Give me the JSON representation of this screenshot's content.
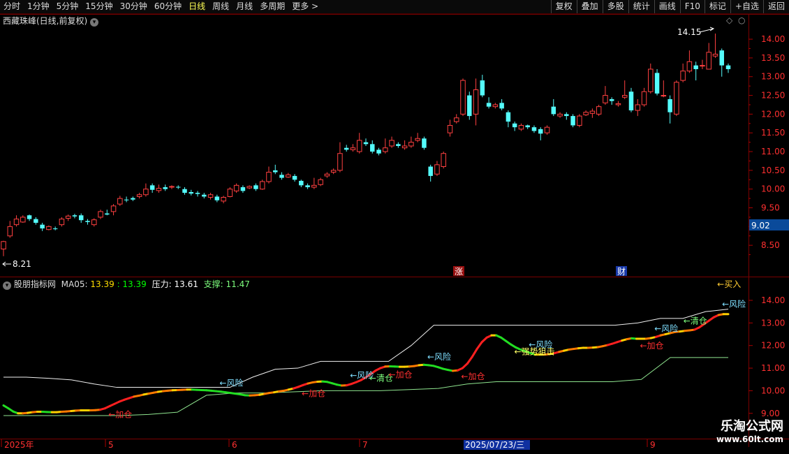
{
  "toolbar": {
    "periods": [
      "分时",
      "1分钟",
      "5分钟",
      "15分钟",
      "30分钟",
      "60分钟",
      "日线",
      "周线",
      "月线",
      "多周期",
      "更多 >"
    ],
    "active_period": "日线",
    "right_buttons": [
      "复权",
      "叠加",
      "多股",
      "统计",
      "画线",
      "F10",
      "标记",
      "+自选",
      "返回"
    ]
  },
  "main_panel": {
    "title": "西藏珠峰(日线,前复权)",
    "price_axis": [
      "14.00",
      "13.50",
      "13.00",
      "12.50",
      "12.00",
      "11.50",
      "11.00",
      "10.50",
      "10.00",
      "9.50",
      "9.00",
      "8.50"
    ],
    "current_price_tag": "9.02",
    "high_marker": "14.15",
    "low_marker": "8.21",
    "badge_zhang": "涨",
    "badge_cai": "财",
    "colors": {
      "up": "#ff4040",
      "down": "#54fcfc"
    }
  },
  "indicator_panel": {
    "title": "股朋指标网",
    "ma_label": "MA05:",
    "ma_value1": "13.39",
    "ma_value2": ": 13.39",
    "resistance_label": "压力:",
    "resistance_value": "13.61",
    "support_label": "支撑:",
    "support_value": "11.47",
    "price_axis": [
      "14.00",
      "13.00",
      "12.00",
      "11.00",
      "10.00",
      "9.00"
    ],
    "signals": [
      "←加仓",
      "←风险",
      "←加仓",
      "←风险",
      "←清仓",
      "←加仓",
      "←风险",
      "←加仓",
      "←强势狙击",
      "←风险",
      "←加仓",
      "←风险",
      "←清仓",
      "←风险",
      "←买入"
    ]
  },
  "date_axis": {
    "labels": [
      "2025年",
      "5",
      "6",
      "7",
      "9"
    ],
    "cursor_date": "2025/07/23/三"
  },
  "watermark": {
    "site_name": "乐淘公式网",
    "url": "www.60lt.com"
  },
  "chart_data": [
    {
      "type": "candlestick",
      "title": "西藏珠峰(日线,前复权)",
      "y_axis": {
        "min": 8.0,
        "max": 14.3
      },
      "up_color": "#ff4040",
      "down_color": "#54fcfc",
      "candles": [
        {
          "o": 8.4,
          "c": 8.6,
          "h": 8.62,
          "l": 8.21
        },
        {
          "o": 8.75,
          "c": 9.0,
          "h": 9.15,
          "l": 8.7
        },
        {
          "o": 9.05,
          "c": 9.2,
          "h": 9.3,
          "l": 9.0
        },
        {
          "o": 9.12,
          "c": 9.25,
          "h": 9.3,
          "l": 9.1
        },
        {
          "o": 9.3,
          "c": 9.2,
          "h": 9.32,
          "l": 9.15
        },
        {
          "o": 9.2,
          "c": 9.1,
          "h": 9.25,
          "l": 9.05
        },
        {
          "o": 9.05,
          "c": 8.95,
          "h": 9.1,
          "l": 8.88
        },
        {
          "o": 8.92,
          "c": 9.0,
          "h": 9.03,
          "l": 8.9
        },
        {
          "o": 8.95,
          "c": 8.93,
          "h": 9.0,
          "l": 8.9
        },
        {
          "o": 9.05,
          "c": 9.2,
          "h": 9.25,
          "l": 9.0
        },
        {
          "o": 9.22,
          "c": 9.28,
          "h": 9.32,
          "l": 9.15
        },
        {
          "o": 9.3,
          "c": 9.27,
          "h": 9.34,
          "l": 9.22
        },
        {
          "o": 9.3,
          "c": 9.17,
          "h": 9.35,
          "l": 9.1
        },
        {
          "o": 9.15,
          "c": 9.12,
          "h": 9.2,
          "l": 9.05
        },
        {
          "o": 9.05,
          "c": 9.18,
          "h": 9.22,
          "l": 9.0
        },
        {
          "o": 9.25,
          "c": 9.4,
          "h": 9.45,
          "l": 9.2
        },
        {
          "o": 9.35,
          "c": 9.32,
          "h": 9.45,
          "l": 9.3
        },
        {
          "o": 9.4,
          "c": 9.55,
          "h": 9.6,
          "l": 9.3
        },
        {
          "o": 9.6,
          "c": 9.75,
          "h": 9.82,
          "l": 9.55
        },
        {
          "o": 9.72,
          "c": 9.7,
          "h": 9.8,
          "l": 9.65
        },
        {
          "o": 9.76,
          "c": 9.72,
          "h": 9.8,
          "l": 9.68
        },
        {
          "o": 9.8,
          "c": 9.85,
          "h": 9.9,
          "l": 9.75
        },
        {
          "o": 9.85,
          "c": 10.0,
          "h": 10.15,
          "l": 9.8
        },
        {
          "o": 10.1,
          "c": 9.98,
          "h": 10.15,
          "l": 9.9
        },
        {
          "o": 9.96,
          "c": 10.02,
          "h": 10.12,
          "l": 9.9
        },
        {
          "o": 10.05,
          "c": 10.0,
          "h": 10.12,
          "l": 9.95
        },
        {
          "o": 10.05,
          "c": 10.07,
          "h": 10.1,
          "l": 10.0
        },
        {
          "o": 10.06,
          "c": 10.04,
          "h": 10.1,
          "l": 10.0
        },
        {
          "o": 10.0,
          "c": 9.9,
          "h": 10.05,
          "l": 9.85
        },
        {
          "o": 9.92,
          "c": 9.88,
          "h": 9.98,
          "l": 9.83
        },
        {
          "o": 9.9,
          "c": 9.87,
          "h": 9.95,
          "l": 9.8
        },
        {
          "o": 9.85,
          "c": 9.8,
          "h": 9.9,
          "l": 9.75
        },
        {
          "o": 9.78,
          "c": 9.85,
          "h": 9.9,
          "l": 9.72
        },
        {
          "o": 9.8,
          "c": 9.7,
          "h": 9.85,
          "l": 9.65
        },
        {
          "o": 9.68,
          "c": 9.78,
          "h": 9.82,
          "l": 9.62
        },
        {
          "o": 9.8,
          "c": 10.0,
          "h": 10.05,
          "l": 9.78
        },
        {
          "o": 9.95,
          "c": 10.1,
          "h": 10.15,
          "l": 9.9
        },
        {
          "o": 10.05,
          "c": 9.95,
          "h": 10.1,
          "l": 9.9
        },
        {
          "o": 10.03,
          "c": 10.07,
          "h": 10.1,
          "l": 10.0
        },
        {
          "o": 10.1,
          "c": 10.0,
          "h": 10.15,
          "l": 9.95
        },
        {
          "o": 10.0,
          "c": 10.2,
          "h": 10.25,
          "l": 9.98
        },
        {
          "o": 10.2,
          "c": 10.45,
          "h": 10.6,
          "l": 10.15
        },
        {
          "o": 10.5,
          "c": 10.45,
          "h": 10.65,
          "l": 10.4
        },
        {
          "o": 10.38,
          "c": 10.3,
          "h": 10.45,
          "l": 10.25
        },
        {
          "o": 10.32,
          "c": 10.38,
          "h": 10.43,
          "l": 10.3
        },
        {
          "o": 10.35,
          "c": 10.25,
          "h": 10.4,
          "l": 10.2
        },
        {
          "o": 10.22,
          "c": 10.1,
          "h": 10.25,
          "l": 10.05
        },
        {
          "o": 10.1,
          "c": 10.05,
          "h": 10.15,
          "l": 10.0
        },
        {
          "o": 10.05,
          "c": 10.1,
          "h": 10.3,
          "l": 10.0
        },
        {
          "o": 10.12,
          "c": 10.25,
          "h": 10.3,
          "l": 10.08
        },
        {
          "o": 10.35,
          "c": 10.4,
          "h": 10.45,
          "l": 10.3
        },
        {
          "o": 10.45,
          "c": 10.5,
          "h": 10.55,
          "l": 10.4
        },
        {
          "o": 10.5,
          "c": 10.95,
          "h": 11.25,
          "l": 10.45
        },
        {
          "o": 11.1,
          "c": 11.05,
          "h": 11.18,
          "l": 11.0
        },
        {
          "o": 11.05,
          "c": 11.1,
          "h": 11.2,
          "l": 11.0
        },
        {
          "o": 11.0,
          "c": 11.3,
          "h": 11.5,
          "l": 10.95
        },
        {
          "o": 11.25,
          "c": 11.2,
          "h": 11.35,
          "l": 11.15
        },
        {
          "o": 11.2,
          "c": 11.0,
          "h": 11.3,
          "l": 10.95
        },
        {
          "o": 11.05,
          "c": 10.95,
          "h": 11.1,
          "l": 10.9
        },
        {
          "o": 11.0,
          "c": 11.1,
          "h": 11.35,
          "l": 10.95
        },
        {
          "o": 11.15,
          "c": 11.3,
          "h": 11.4,
          "l": 11.1
        },
        {
          "o": 11.2,
          "c": 11.15,
          "h": 11.25,
          "l": 11.1
        },
        {
          "o": 11.1,
          "c": 11.15,
          "h": 11.3,
          "l": 11.05
        },
        {
          "o": 11.15,
          "c": 11.25,
          "h": 11.4,
          "l": 11.1
        },
        {
          "o": 11.3,
          "c": 11.35,
          "h": 11.5,
          "l": 11.25
        },
        {
          "o": 11.35,
          "c": 11.1,
          "h": 11.4,
          "l": 11.05
        },
        {
          "o": 10.6,
          "c": 10.35,
          "h": 10.65,
          "l": 10.2
        },
        {
          "o": 10.4,
          "c": 10.65,
          "h": 10.75,
          "l": 10.35
        },
        {
          "o": 10.6,
          "c": 10.95,
          "h": 11.0,
          "l": 10.55
        },
        {
          "o": 11.5,
          "c": 11.7,
          "h": 11.85,
          "l": 11.4
        },
        {
          "o": 11.8,
          "c": 11.9,
          "h": 12.0,
          "l": 11.75
        },
        {
          "o": 12.0,
          "c": 12.9,
          "h": 12.95,
          "l": 11.95
        },
        {
          "o": 12.5,
          "c": 11.95,
          "h": 12.6,
          "l": 11.85
        },
        {
          "o": 12.0,
          "c": 12.65,
          "h": 12.95,
          "l": 11.7
        },
        {
          "o": 12.9,
          "c": 12.5,
          "h": 13.05,
          "l": 12.45
        },
        {
          "o": 12.3,
          "c": 12.2,
          "h": 12.45,
          "l": 12.15
        },
        {
          "o": 12.2,
          "c": 12.25,
          "h": 12.3,
          "l": 12.15
        },
        {
          "o": 12.3,
          "c": 12.15,
          "h": 12.4,
          "l": 12.1
        },
        {
          "o": 12.05,
          "c": 11.8,
          "h": 12.1,
          "l": 11.65
        },
        {
          "o": 11.75,
          "c": 11.65,
          "h": 11.8,
          "l": 11.55
        },
        {
          "o": 11.6,
          "c": 11.7,
          "h": 11.75,
          "l": 11.55
        },
        {
          "o": 11.7,
          "c": 11.65,
          "h": 11.72,
          "l": 11.6
        },
        {
          "o": 11.65,
          "c": 11.55,
          "h": 11.7,
          "l": 11.5
        },
        {
          "o": 11.6,
          "c": 11.48,
          "h": 11.65,
          "l": 11.3
        },
        {
          "o": 11.5,
          "c": 11.65,
          "h": 11.7,
          "l": 11.45
        },
        {
          "o": 12.2,
          "c": 12.0,
          "h": 12.4,
          "l": 11.95
        },
        {
          "o": 11.95,
          "c": 12.0,
          "h": 12.05,
          "l": 11.9
        },
        {
          "o": 12.0,
          "c": 11.95,
          "h": 12.05,
          "l": 11.85
        },
        {
          "o": 11.95,
          "c": 11.7,
          "h": 12.0,
          "l": 11.65
        },
        {
          "o": 11.7,
          "c": 11.95,
          "h": 12.0,
          "l": 11.65
        },
        {
          "o": 11.98,
          "c": 12.05,
          "h": 12.1,
          "l": 11.95
        },
        {
          "o": 12.02,
          "c": 12.08,
          "h": 12.15,
          "l": 11.9
        },
        {
          "o": 12.0,
          "c": 12.2,
          "h": 12.25,
          "l": 11.95
        },
        {
          "o": 12.3,
          "c": 12.5,
          "h": 12.75,
          "l": 12.25
        },
        {
          "o": 12.4,
          "c": 12.35,
          "h": 12.45,
          "l": 12.25
        },
        {
          "o": 12.25,
          "c": 12.28,
          "h": 12.35,
          "l": 12.2
        },
        {
          "o": 12.45,
          "c": 12.5,
          "h": 12.9,
          "l": 12.4
        },
        {
          "o": 12.6,
          "c": 12.1,
          "h": 12.7,
          "l": 12.05
        },
        {
          "o": 12.1,
          "c": 12.25,
          "h": 12.4,
          "l": 11.95
        },
        {
          "o": 12.25,
          "c": 12.6,
          "h": 12.7,
          "l": 12.2
        },
        {
          "o": 12.6,
          "c": 13.2,
          "h": 13.35,
          "l": 12.55
        },
        {
          "o": 13.1,
          "c": 12.55,
          "h": 13.2,
          "l": 12.5
        },
        {
          "o": 12.5,
          "c": 12.5,
          "h": 12.9,
          "l": 12.45
        },
        {
          "o": 12.4,
          "c": 12.05,
          "h": 12.5,
          "l": 11.75
        },
        {
          "o": 12.0,
          "c": 12.85,
          "h": 12.9,
          "l": 11.95
        },
        {
          "o": 12.9,
          "c": 13.15,
          "h": 13.35,
          "l": 12.85
        },
        {
          "o": 13.15,
          "c": 13.4,
          "h": 13.7,
          "l": 13.1
        },
        {
          "o": 13.3,
          "c": 13.2,
          "h": 13.4,
          "l": 12.9
        },
        {
          "o": 13.3,
          "c": 13.3,
          "h": 13.45,
          "l": 13.2
        },
        {
          "o": 13.2,
          "c": 13.65,
          "h": 13.9,
          "l": 13.2
        },
        {
          "o": 13.55,
          "c": 13.6,
          "h": 14.15,
          "l": 13.5
        },
        {
          "o": 13.7,
          "c": 13.3,
          "h": 13.75,
          "l": 13.0
        },
        {
          "o": 13.3,
          "c": 13.2,
          "h": 13.35,
          "l": 13.1
        }
      ]
    },
    {
      "type": "line",
      "title": "股朋指标网",
      "y_axis": {
        "min": 8.9,
        "max": 14.6
      },
      "series": [
        {
          "name": "MA05",
          "values": [
            9.35,
            9.22,
            9.08,
            9.0,
            9.0,
            9.02,
            9.05,
            9.07,
            9.07,
            9.06,
            9.05,
            9.05,
            9.07,
            9.08,
            9.1,
            9.12,
            9.13,
            9.13,
            9.13,
            9.14,
            9.16,
            9.22,
            9.32,
            9.42,
            9.52,
            9.6,
            9.67,
            9.74,
            9.78,
            9.83,
            9.87,
            9.91,
            9.95,
            9.98,
            10.0,
            10.02,
            10.03,
            10.04,
            10.05,
            10.05,
            10.04,
            10.03,
            10.02,
            10.0,
            9.98,
            9.96,
            9.93,
            9.9,
            9.87,
            9.84,
            9.8,
            9.79,
            9.8,
            9.82,
            9.86,
            9.9,
            9.93,
            9.97,
            10.0,
            10.05,
            10.1,
            10.17,
            10.25,
            10.32,
            10.37,
            10.4,
            10.41,
            10.39,
            10.33,
            10.27,
            10.23,
            10.24,
            10.3,
            10.38,
            10.47,
            10.59,
            10.74,
            10.89,
            11.0,
            11.07,
            11.08,
            11.07,
            11.06,
            11.06,
            11.07,
            11.09,
            11.13,
            11.15,
            11.13,
            11.1,
            11.04,
            10.97,
            10.92,
            10.88,
            10.9,
            11.0,
            11.2,
            11.5,
            11.85,
            12.15,
            12.35,
            12.45,
            12.45,
            12.35,
            12.2,
            12.05,
            11.92,
            11.82,
            11.75,
            11.67,
            11.6,
            11.6,
            11.6,
            11.62,
            11.66,
            11.72,
            11.77,
            11.82,
            11.85,
            11.88,
            11.9,
            11.9,
            11.91,
            11.93,
            11.97,
            12.02,
            12.08,
            12.15,
            12.22,
            12.28,
            12.32,
            12.3,
            12.3,
            12.3,
            12.33,
            12.38,
            12.45,
            12.5,
            12.55,
            12.6,
            12.62,
            12.65,
            12.67,
            12.7,
            12.8,
            12.95,
            13.1,
            13.25,
            13.35,
            13.39,
            13.39
          ]
        },
        {
          "name": "压力",
          "values": [
            10.6,
            10.6,
            10.55,
            10.48,
            10.3,
            10.15,
            10.15,
            10.15,
            10.15,
            10.15,
            10.15,
            10.6,
            10.95,
            11.0,
            11.3,
            11.3,
            11.3,
            11.3,
            12.0,
            12.9,
            12.9,
            12.9,
            12.9,
            12.9,
            12.9,
            12.9,
            12.9,
            12.9,
            13.0,
            13.2,
            13.2,
            13.5,
            13.61
          ]
        },
        {
          "name": "支撑",
          "values": [
            8.9,
            8.9,
            8.9,
            8.9,
            8.9,
            8.95,
            9.05,
            9.8,
            9.9,
            9.9,
            9.95,
            10.0,
            10.0,
            10.0,
            10.05,
            10.1,
            10.3,
            10.4,
            10.4,
            10.4,
            10.4,
            10.4,
            10.5,
            11.47,
            11.47,
            11.47
          ]
        }
      ]
    }
  ]
}
